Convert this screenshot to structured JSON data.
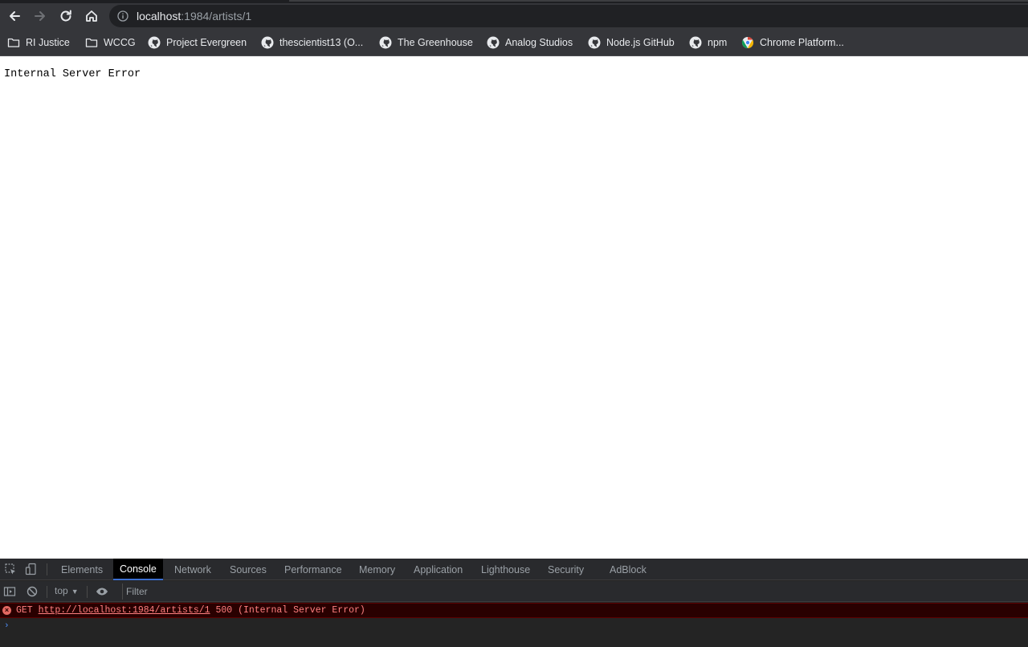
{
  "browser": {
    "url_host": "localhost",
    "url_path": ":1984/artists/1",
    "nav_icons": [
      "back-icon",
      "forward-icon",
      "reload-icon",
      "home-icon",
      "info-icon"
    ]
  },
  "bookmarks": [
    {
      "label": "RI Justice",
      "icon": "folder-icon"
    },
    {
      "label": "WCCG",
      "icon": "folder-icon"
    },
    {
      "label": "Project Evergreen",
      "icon": "github-icon"
    },
    {
      "label": "thescientist13 (O...",
      "icon": "github-icon"
    },
    {
      "label": "The Greenhouse",
      "icon": "github-icon"
    },
    {
      "label": "Analog Studios",
      "icon": "github-icon"
    },
    {
      "label": "Node.js GitHub",
      "icon": "github-icon"
    },
    {
      "label": "npm",
      "icon": "github-icon"
    },
    {
      "label": "Chrome Platform...",
      "icon": "chrome-icon"
    }
  ],
  "page": {
    "body_text": "Internal Server Error"
  },
  "devtools": {
    "tabs": [
      "Elements",
      "Console",
      "Network",
      "Sources",
      "Performance",
      "Memory",
      "Application",
      "Lighthouse",
      "Security",
      "AdBlock"
    ],
    "active_tab": "Console",
    "context": "top",
    "filter_placeholder": "Filter",
    "error": {
      "method": "GET",
      "url": "http://localhost:1984/artists/1",
      "status": "500 (Internal Server Error)"
    },
    "prompt": "›"
  },
  "colors": {
    "chrome_bg": "#35363a",
    "omnibox_bg": "#202124",
    "devtools_bg": "#242424",
    "error_bg": "#290000",
    "error_text": "#ff8080",
    "active_tab_accent": "#3c6fd0"
  }
}
